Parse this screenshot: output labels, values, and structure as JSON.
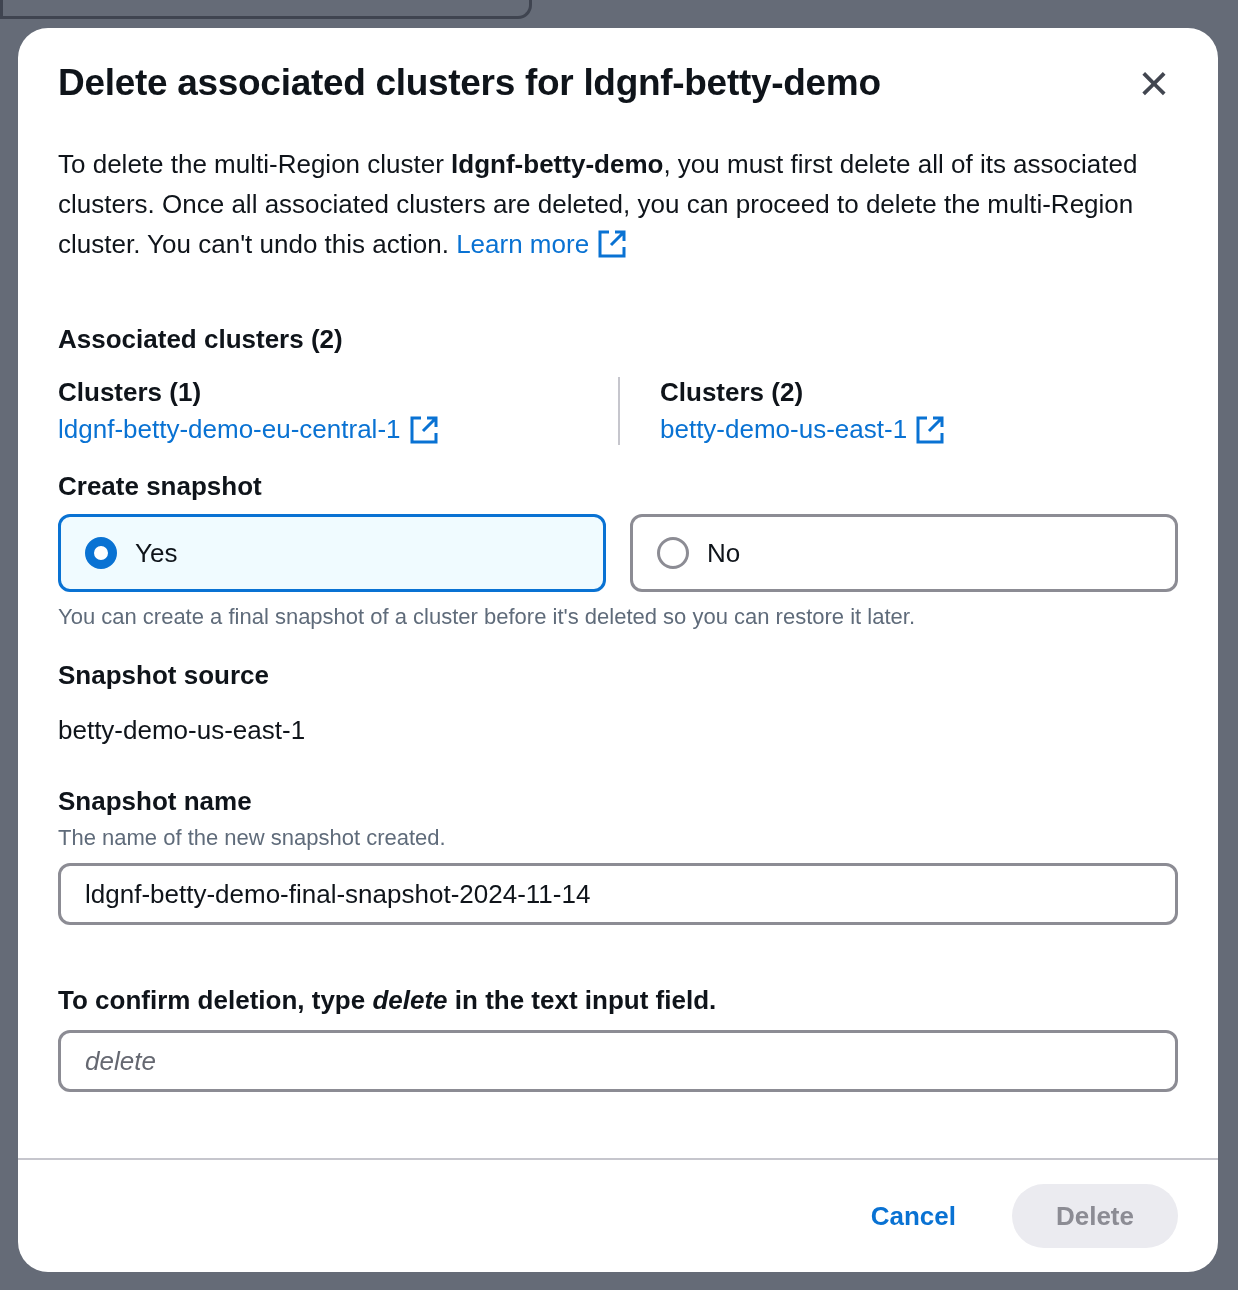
{
  "dialog": {
    "title": "Delete associated clusters for ldgnf-betty-demo",
    "close_label": "×",
    "intro": "To delete the multi-Region cluster **ldgnf-betty-demo**, you must first delete all of its associated clusters. Once all associated clusters are deleted, you can proceed to delete the multi-Region cluster. You can't undo this action.",
    "learn_more": "Learn more",
    "associated_heading": "Associated clusters (2)",
    "cluster_groups": [
      {
        "label": "Clusters (1)",
        "link": "ldgnf-betty-demo-eu-central-1"
      },
      {
        "label": "Clusters (2)",
        "link": "betty-demo-us-east-1"
      }
    ],
    "snapshot": {
      "label": "Create snapshot",
      "options": [
        {
          "label": "Yes",
          "selected": true
        },
        {
          "label": "No",
          "selected": false
        }
      ],
      "hint": "You can create a final snapshot of a cluster before it's deleted so you can restore it later."
    },
    "source": {
      "label": "Snapshot source",
      "value": "betty-demo-us-east-1"
    },
    "name": {
      "label": "Snapshot name",
      "hint": "The name of the new snapshot created.",
      "value": "ldgnf-betty-demo-final-snapshot-2024-11-14"
    },
    "confirm": {
      "label": "To confirm deletion, type *delete* in the text input field.",
      "placeholder": "delete"
    },
    "buttons": [
      {
        "label": "Cancel",
        "kind": "link",
        "disabled": false
      },
      {
        "label": "Delete",
        "kind": "primary",
        "disabled": true
      }
    ]
  }
}
